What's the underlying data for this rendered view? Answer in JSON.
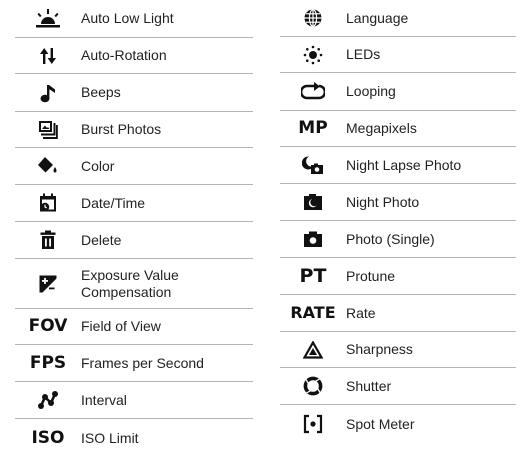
{
  "left_column": [
    {
      "icon": "sun-horizon-icon",
      "label": "Auto Low Light"
    },
    {
      "icon": "rotate-arrows-icon",
      "label": "Auto-Rotation"
    },
    {
      "icon": "music-note-icon",
      "label": "Beeps"
    },
    {
      "icon": "burst-photos-icon",
      "label": "Burst Photos"
    },
    {
      "icon": "paint-bucket-icon",
      "label": "Color"
    },
    {
      "icon": "calendar-clock-icon",
      "label": "Date/Time"
    },
    {
      "icon": "trash-icon",
      "label": "Delete"
    },
    {
      "icon": "exposure-icon",
      "label": "Exposure Value Compensation"
    },
    {
      "icon": "fov-icon",
      "icon_text": "FOV",
      "label": "Field of View"
    },
    {
      "icon": "fps-icon",
      "icon_text": "FPS",
      "label": "Frames per Second"
    },
    {
      "icon": "interval-icon",
      "label": "Interval"
    },
    {
      "icon": "iso-icon",
      "icon_text": "ISO",
      "label": "ISO Limit"
    }
  ],
  "right_column": [
    {
      "icon": "globe-icon",
      "label": "Language"
    },
    {
      "icon": "led-icon",
      "label": "LEDs"
    },
    {
      "icon": "looping-icon",
      "label": "Looping"
    },
    {
      "icon": "megapixels-icon",
      "icon_text": "MP",
      "label": "Megapixels"
    },
    {
      "icon": "night-lapse-photo-icon",
      "label": "Night Lapse Photo"
    },
    {
      "icon": "night-photo-icon",
      "label": "Night Photo"
    },
    {
      "icon": "camera-icon",
      "label": "Photo (Single)"
    },
    {
      "icon": "protune-icon",
      "icon_text": "PT",
      "label": "Protune"
    },
    {
      "icon": "rate-icon",
      "icon_text": "RATE",
      "label": "Rate"
    },
    {
      "icon": "sharpness-icon",
      "label": "Sharpness"
    },
    {
      "icon": "shutter-icon",
      "label": "Shutter"
    },
    {
      "icon": "spot-meter-icon",
      "label": "Spot Meter"
    }
  ]
}
